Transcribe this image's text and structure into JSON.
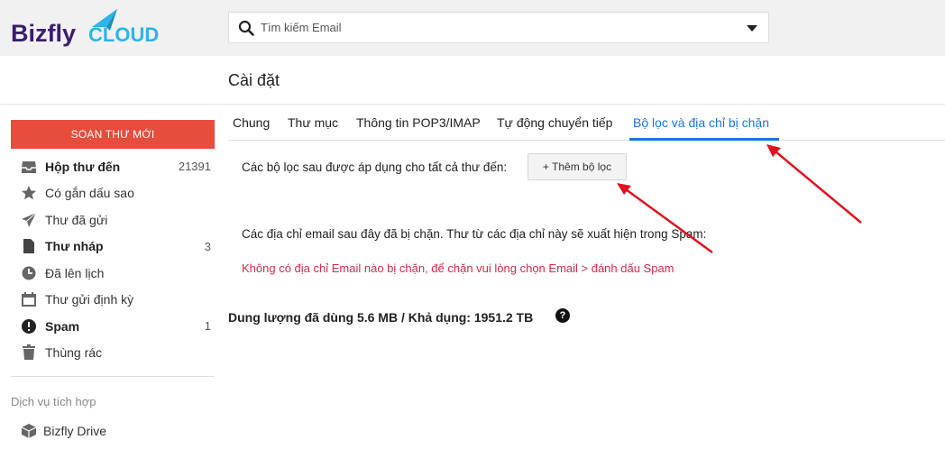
{
  "brand": {
    "logo_text_1": "Bizfly",
    "logo_text_2": "CLOUD"
  },
  "search": {
    "placeholder": "Tìm kiếm Email"
  },
  "page": {
    "title": "Cài đặt"
  },
  "sidebar": {
    "compose_label": "SOẠN THƯ MỚI",
    "items": [
      {
        "label": "Hộp thư đến",
        "count": "21391",
        "icon": "inbox-icon"
      },
      {
        "label": "Có gắn dấu sao",
        "count": "",
        "icon": "star-icon"
      },
      {
        "label": "Thư đã gửi",
        "count": "",
        "icon": "send-icon"
      },
      {
        "label": "Thư nháp",
        "count": "3",
        "icon": "draft-icon"
      },
      {
        "label": "Đã lên lịch",
        "count": "",
        "icon": "clock-icon"
      },
      {
        "label": "Thư gửi định kỳ",
        "count": "",
        "icon": "calendar-icon"
      },
      {
        "label": "Spam",
        "count": "1",
        "icon": "spam-icon"
      },
      {
        "label": "Thùng rác",
        "count": "",
        "icon": "trash-icon"
      }
    ],
    "section_label": "Dịch vụ tích hợp",
    "drive_label": "Bizfly Drive"
  },
  "tabs": [
    {
      "label": "Chung"
    },
    {
      "label": "Thư mục"
    },
    {
      "label": "Thông tin POP3/IMAP"
    },
    {
      "label": "Tự động chuyển tiếp"
    },
    {
      "label": "Bộ lọc và địa chỉ bị chặn",
      "active": true
    }
  ],
  "filters": {
    "description": "Các bộ lọc sau được áp dụng cho tất cả thư đến:",
    "add_button": "+ Thêm bộ lọc"
  },
  "blocked": {
    "description": "Các địa chỉ email sau đây đã bị chặn. Thư từ các địa chỉ này sẽ xuất hiện trong Spam:",
    "empty_message": "Không có địa chỉ Email nào bị chặn, để chặn vui lòng chọn Email > đánh dấu Spam"
  },
  "storage": {
    "usage_text": "Dung lượng đã dùng 5.6 MB / Khả dụng: 1951.2 TB",
    "help_glyph": "?"
  },
  "colors": {
    "accent": "#1a73e8",
    "compose": "#e84c3d",
    "warning_text": "#d72b4a",
    "annotation_arrow": "#e0141e",
    "logo_dark": "#3a1d6e",
    "logo_light": "#2bb5e8"
  }
}
